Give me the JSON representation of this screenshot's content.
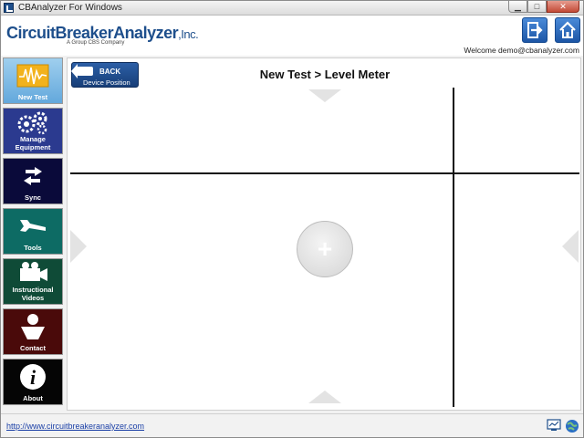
{
  "window": {
    "title": "CBAnalyzer For Windows",
    "minimize_glyph": "▁",
    "maximize_glyph": "□",
    "close_glyph": "✕"
  },
  "header": {
    "logo_part1": "Circuit",
    "logo_part2": "BreakerAnalyzer",
    "logo_part3": ",Inc.",
    "logo_tagline": "A Group CBS Company",
    "welcome": "Welcome demo@cbanalyzer.com"
  },
  "sidebar": {
    "items": [
      {
        "label": "New Test",
        "icon": "waveform-icon"
      },
      {
        "label": "Manage Equipment",
        "icon": "gears-icon"
      },
      {
        "label": "Sync",
        "icon": "sync-arrows-icon"
      },
      {
        "label": "Tools",
        "icon": "wrench-icon"
      },
      {
        "label": "Instructional Videos",
        "icon": "video-camera-icon"
      },
      {
        "label": "Contact",
        "icon": "person-icon"
      },
      {
        "label": "About",
        "icon": "info-icon"
      }
    ]
  },
  "main": {
    "back_label": "BACK",
    "back_sub": "Device Position",
    "title": "New Test > Level Meter",
    "add_glyph": "+"
  },
  "statusbar": {
    "url": "http://www.circuitbreakeranalyzer.com"
  },
  "colors": {
    "brand_blue": "#1e4f8c",
    "new_test_bg": "#63a8dc"
  }
}
